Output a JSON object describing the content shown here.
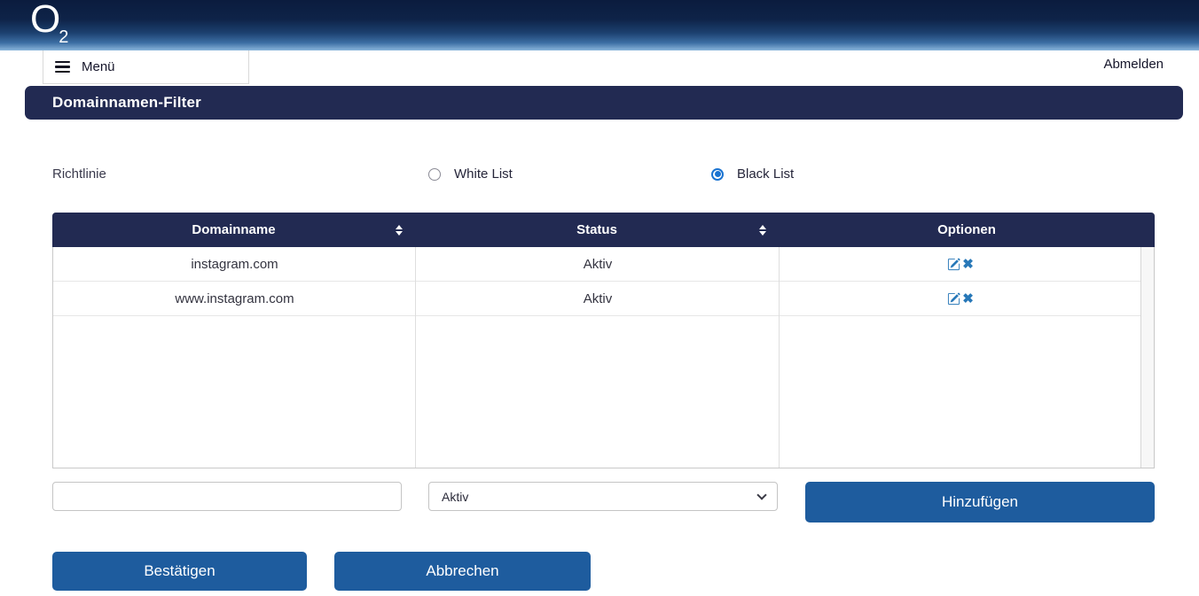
{
  "brand": {
    "logo": "O",
    "logo_sub": "2"
  },
  "nav": {
    "menu_label": "Menü",
    "logout_label": "Abmelden"
  },
  "page": {
    "title": "Domainnamen-Filter"
  },
  "policy": {
    "label": "Richtlinie",
    "options": [
      {
        "label": "White List",
        "selected": false
      },
      {
        "label": "Black List",
        "selected": true
      }
    ]
  },
  "table": {
    "columns": [
      {
        "label": "Domainname",
        "sortable": true
      },
      {
        "label": "Status",
        "sortable": true
      },
      {
        "label": "Optionen",
        "sortable": false
      }
    ],
    "rows": [
      {
        "domain": "instagram.com",
        "status": "Aktiv"
      },
      {
        "domain": "www.instagram.com",
        "status": "Aktiv"
      }
    ]
  },
  "add_form": {
    "domain_input_value": "",
    "status_selected": "Aktiv",
    "submit_label": "Hinzufügen"
  },
  "footer_actions": {
    "confirm_label": "Bestätigen",
    "cancel_label": "Abbrechen"
  },
  "icons": {
    "delete_glyph": "✖"
  },
  "colors": {
    "navy_bar": "#222a52",
    "button_blue": "#1e5c9e",
    "icon_blue": "#2878b8",
    "radio_selected_blue": "#1a73d1"
  }
}
